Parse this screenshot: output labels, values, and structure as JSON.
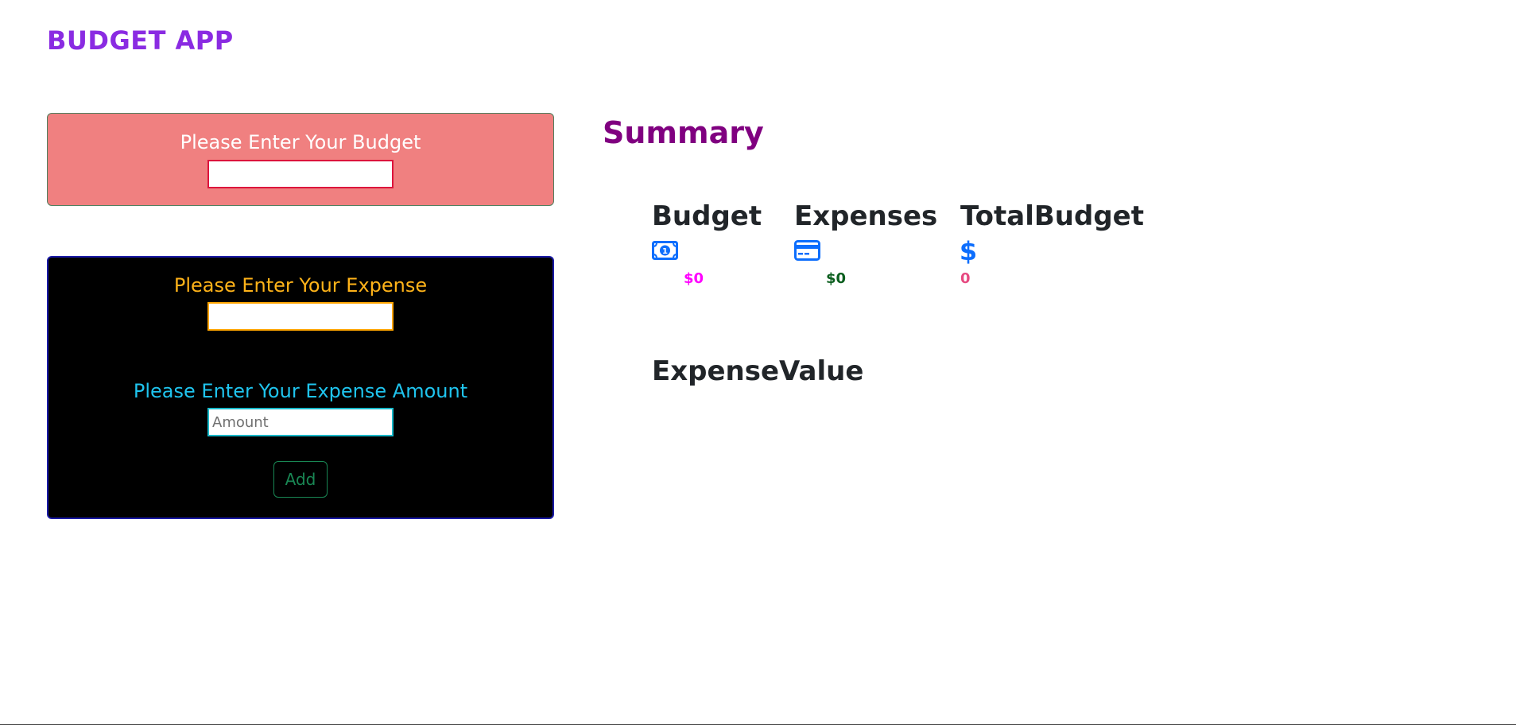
{
  "app": {
    "title": "BUDGET APP"
  },
  "budget_form": {
    "label": "Please Enter Your Budget",
    "value": "",
    "placeholder": ""
  },
  "expense_form": {
    "name_label": "Please Enter Your Expense",
    "name_value": "",
    "name_placeholder": "",
    "amount_label": "Please Enter Your Expense Amount",
    "amount_value": "",
    "amount_placeholder": "Amount",
    "add_button_label": "Add"
  },
  "summary": {
    "title": "Summary",
    "stats": [
      {
        "heading": "Budget",
        "icon": "cash-icon",
        "value": "$0",
        "color": "#ff00ff"
      },
      {
        "heading": "Expenses",
        "icon": "credit-card-icon",
        "value": "$0",
        "color": "#0b5e1e"
      },
      {
        "heading": "TotalBudget",
        "icon": "dollar-icon",
        "value": "0",
        "color": "#e64980"
      }
    ],
    "expense_value_title": "ExpenseValue"
  },
  "colors": {
    "title": "#8a2be2",
    "budget_card_bg": "#f08080",
    "expense_card_bg": "#000000",
    "expense_label": "#ffb319",
    "amount_label": "#1fc4ee",
    "add_button": "#198754",
    "summary_title": "#800080",
    "icon": "#0d6efd"
  }
}
